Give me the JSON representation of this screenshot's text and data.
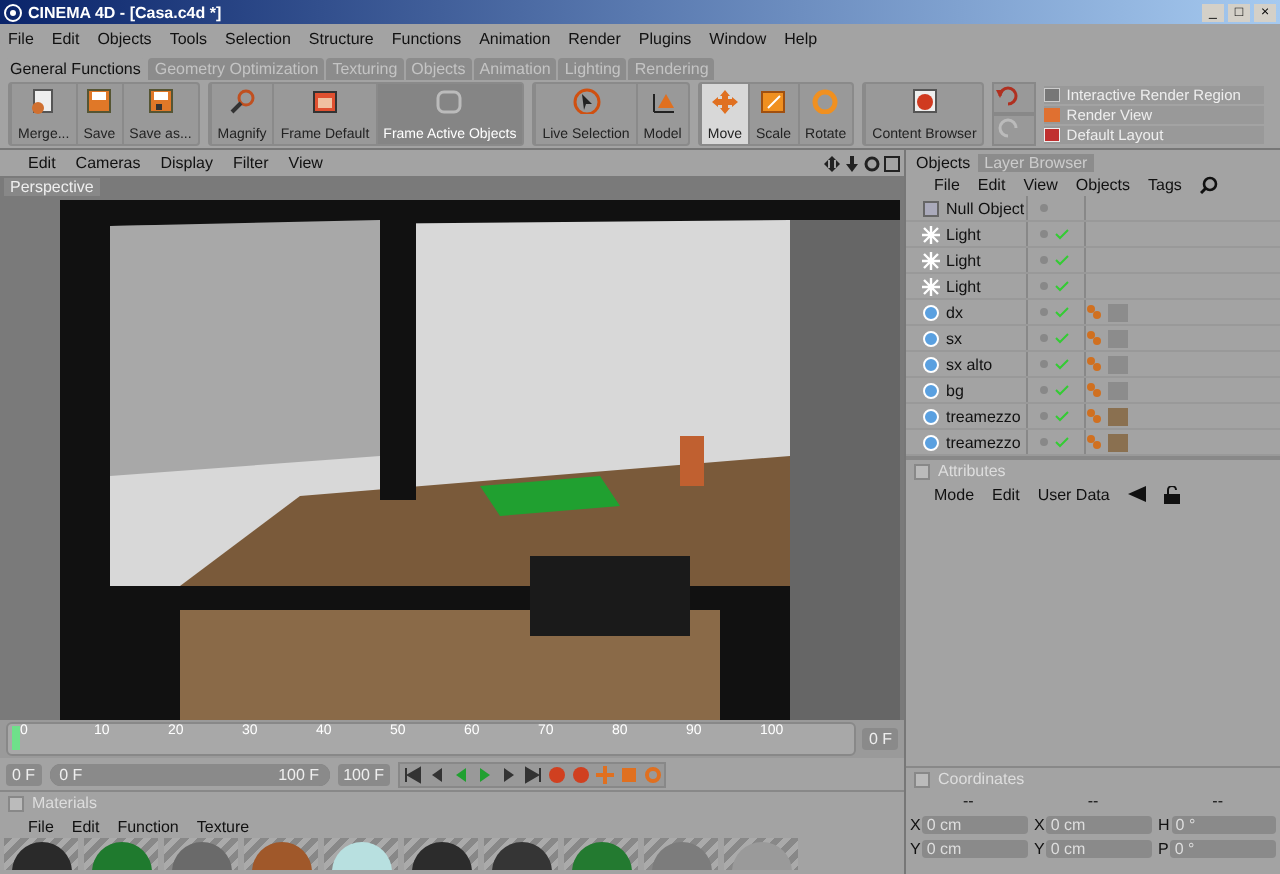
{
  "window": {
    "title": "CINEMA 4D - [Casa.c4d *]",
    "buttons": [
      "_",
      "□",
      "×"
    ]
  },
  "menu": [
    "File",
    "Edit",
    "Objects",
    "Tools",
    "Selection",
    "Structure",
    "Functions",
    "Animation",
    "Render",
    "Plugins",
    "Window",
    "Help"
  ],
  "tabs": [
    {
      "label": "General Functions",
      "selected": true
    },
    {
      "label": "Geometry Optimization",
      "selected": false
    },
    {
      "label": "Texturing",
      "selected": false
    },
    {
      "label": "Objects",
      "selected": false
    },
    {
      "label": "Animation",
      "selected": false
    },
    {
      "label": "Lighting",
      "selected": false
    },
    {
      "label": "Rendering",
      "selected": false
    }
  ],
  "toolbar": [
    {
      "buttons": [
        {
          "label": "Merge...",
          "selected": false,
          "disabled": false
        },
        {
          "label": "Save",
          "selected": false,
          "disabled": false
        },
        {
          "label": "Save as...",
          "selected": false,
          "disabled": false
        }
      ]
    },
    {
      "buttons": [
        {
          "label": "Magnify",
          "selected": false,
          "disabled": false
        },
        {
          "label": "Frame Default",
          "selected": false,
          "disabled": false
        },
        {
          "label": "Frame Active Objects",
          "selected": false,
          "disabled": true
        }
      ]
    },
    {
      "buttons": [
        {
          "label": "Live Selection",
          "selected": false,
          "disabled": false
        },
        {
          "label": "Model",
          "selected": false,
          "disabled": false
        }
      ]
    },
    {
      "buttons": [
        {
          "label": "Move",
          "selected": true,
          "disabled": false
        },
        {
          "label": "Scale",
          "selected": false,
          "disabled": false
        },
        {
          "label": "Rotate",
          "selected": false,
          "disabled": false
        }
      ]
    },
    {
      "buttons": [
        {
          "label": "Content Browser",
          "selected": false,
          "disabled": false
        }
      ]
    }
  ],
  "layouts": [
    "Interactive Render Region",
    "Render View",
    "Default Layout"
  ],
  "viewport": {
    "menu": [
      "Edit",
      "Cameras",
      "Display",
      "Filter",
      "View"
    ],
    "label": "Perspective"
  },
  "timeline": {
    "ticks": [
      "0",
      "10",
      "20",
      "30",
      "40",
      "50",
      "60",
      "70",
      "80",
      "90",
      "100"
    ],
    "level": 0,
    "frame": "0 F"
  },
  "transport": {
    "level": 1,
    "start": "0 F",
    "range_start": "0 F",
    "range_end": "100 F",
    "end": "100 F"
  },
  "materials": {
    "checked": false,
    "title": "Materials",
    "menu": [
      "File",
      "Edit",
      "Function",
      "Texture"
    ],
    "swatches": [
      {
        "color": "#2a2a2a"
      },
      {
        "color": "#1f7a2e"
      },
      {
        "color": "#6a6a6a"
      },
      {
        "color": "#a0582a"
      },
      {
        "color": "#b8e0e0"
      },
      {
        "color": "#2c2c2c"
      },
      {
        "color": "#353535"
      },
      {
        "color": "#237a30"
      },
      {
        "color": "#7c7c7c"
      },
      {
        "color": "#9a9a9a"
      }
    ]
  },
  "objects": {
    "tabs": [
      {
        "label": "Objects",
        "selected": true
      },
      {
        "label": "Layer Browser",
        "selected": false
      }
    ],
    "menu": [
      "File",
      "Edit",
      "View",
      "Objects",
      "Tags"
    ],
    "rows": [
      {
        "name": "Null Object",
        "kind": "null"
      },
      {
        "name": "Light",
        "kind": "light"
      },
      {
        "name": "Light",
        "kind": "light"
      },
      {
        "name": "Light",
        "kind": "light"
      },
      {
        "name": "dx",
        "kind": "object",
        "color": "#8c8c8c"
      },
      {
        "name": "sx",
        "kind": "object",
        "color": "#8c8c8c"
      },
      {
        "name": "sx alto",
        "kind": "object",
        "color": "#8c8c8c"
      },
      {
        "name": "bg",
        "kind": "object",
        "color": "#8c8c8c"
      },
      {
        "name": "treamezzo",
        "kind": "object",
        "color": "#8a7050"
      },
      {
        "name": "treamezzo",
        "kind": "object",
        "color": "#8a7050"
      }
    ]
  },
  "attributes": {
    "checked": false,
    "title": "Attributes",
    "menu": [
      "Mode",
      "Edit",
      "User Data"
    ]
  },
  "coordinates": {
    "checked": false,
    "title": "Coordinates",
    "headers": [
      "--",
      "--",
      "--"
    ],
    "fields": [
      {
        "axis": "X",
        "value": "0 cm"
      },
      {
        "axis": "X",
        "value": "0 cm"
      },
      {
        "axis": "H",
        "value": "0 °"
      },
      {
        "axis": "Y",
        "value": "0 cm"
      },
      {
        "axis": "Y",
        "value": "0 cm"
      },
      {
        "axis": "P",
        "value": "0 °"
      }
    ]
  }
}
